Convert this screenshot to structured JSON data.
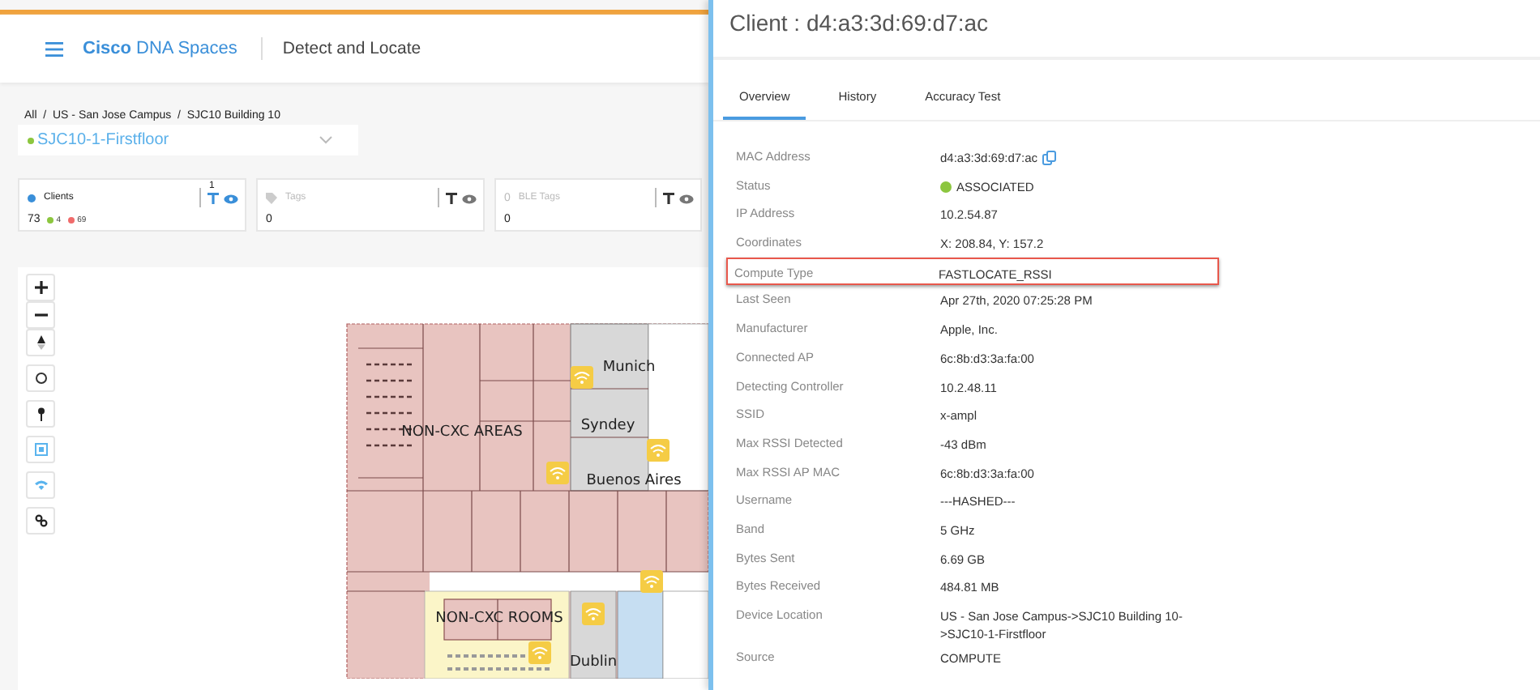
{
  "header": {
    "brand_bold": "Cisco",
    "brand": "DNA Spaces",
    "app": "Detect and Locate"
  },
  "breadcrumb": "All  /  US - San Jose Campus  /  SJC10 Building 10",
  "floor_select": {
    "value": "SJC10-1-Firstfloor"
  },
  "cards": [
    {
      "kind": "clients",
      "title": "Clients",
      "count": "73",
      "filter_count": "1",
      "active": true,
      "sub": [
        {
          "value": "4",
          "color": "#8cc63f"
        },
        {
          "value": "69",
          "color": "#f06b6b"
        }
      ]
    },
    {
      "kind": "tags",
      "title": "Tags",
      "count": "0",
      "active": false
    },
    {
      "kind": "ble",
      "prefix": "0",
      "title": "BLE Tags",
      "count": "0",
      "active": false
    }
  ],
  "map_controls": [
    {
      "kind": "zoom-in",
      "active": false
    },
    {
      "kind": "zoom-out",
      "active": false
    },
    {
      "kind": "compass",
      "active": false
    },
    {
      "kind": "circle",
      "active": false
    },
    {
      "kind": "pin",
      "active": false
    },
    {
      "kind": "fit",
      "active": true
    },
    {
      "kind": "wifi",
      "active": true
    },
    {
      "kind": "link",
      "active": false
    }
  ],
  "rooms": [
    {
      "name": "NON-CXC AREAS"
    },
    {
      "name": "Munich"
    },
    {
      "name": "Syndey"
    },
    {
      "name": "Buenos Aires"
    },
    {
      "name": "NON-CXC ROOMS"
    },
    {
      "name": "Dublin"
    }
  ],
  "panel": {
    "title": "Client : d4:a3:3d:69:d7:ac",
    "tabs": [
      {
        "label": "Overview",
        "selected": true
      },
      {
        "label": "History",
        "selected": false
      },
      {
        "label": "Accuracy Test",
        "selected": false
      }
    ],
    "details": [
      {
        "kind": "copy",
        "label": "MAC Address",
        "value": "d4:a3:3d:69:d7:ac"
      },
      {
        "kind": "status",
        "label": "Status",
        "value": "ASSOCIATED"
      },
      {
        "kind": "plain",
        "label": "IP Address",
        "value": "10.2.54.87"
      },
      {
        "kind": "plain",
        "label": "Coordinates",
        "value": "X: 208.84, Y: 157.2"
      },
      {
        "kind": "highlighted",
        "label": "Compute Type",
        "value": "FASTLOCATE_RSSI"
      },
      {
        "kind": "plain",
        "label": "Last Seen",
        "value": "Apr 27th, 2020 07:25:28 PM"
      },
      {
        "kind": "plain",
        "label": "Manufacturer",
        "value": "Apple, Inc."
      },
      {
        "kind": "plain",
        "label": "Connected AP",
        "value": "6c:8b:d3:3a:fa:00"
      },
      {
        "kind": "plain",
        "label": "Detecting Controller",
        "value": "10.2.48.11"
      },
      {
        "kind": "plain",
        "label": "SSID",
        "value": "x-ampl"
      },
      {
        "kind": "plain",
        "label": "Max RSSI Detected",
        "value": "-43 dBm"
      },
      {
        "kind": "plain",
        "label": "Max RSSI AP MAC",
        "value": "6c:8b:d3:3a:fa:00"
      },
      {
        "kind": "plain",
        "label": "Username",
        "value": "---HASHED---"
      },
      {
        "kind": "plain",
        "label": "Band",
        "value": "5 GHz"
      },
      {
        "kind": "plain",
        "label": "Bytes Sent",
        "value": "6.69 GB"
      },
      {
        "kind": "plain",
        "label": "Bytes Received",
        "value": "484.81 MB"
      },
      {
        "kind": "plain",
        "label": "Device Location",
        "value": "US - San Jose Campus->SJC10 Building 10->SJC10-1-Firstfloor"
      },
      {
        "kind": "plain",
        "label": "Source",
        "value": "COMPUTE"
      }
    ]
  }
}
